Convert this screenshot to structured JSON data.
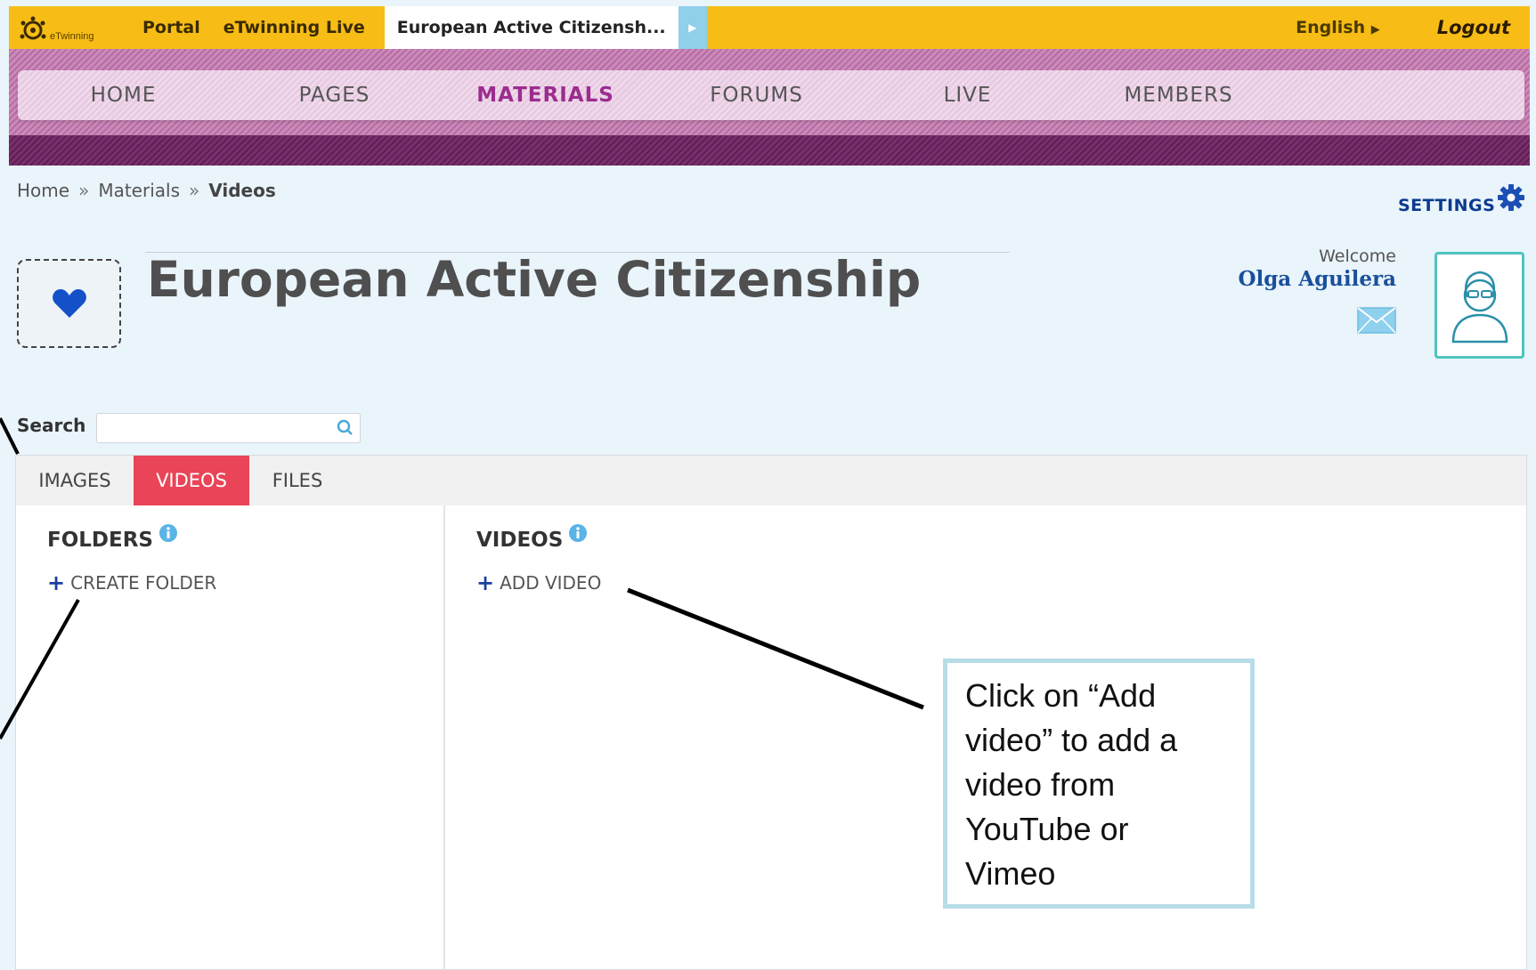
{
  "topbar": {
    "logo_text": "eTwinning",
    "links": [
      "Portal",
      "eTwinning Live"
    ],
    "active_tab": "European Active Citizensh...",
    "language": "English",
    "logout": "Logout"
  },
  "nav": {
    "items": [
      "HOME",
      "PAGES",
      "MATERIALS",
      "FORUMS",
      "LIVE",
      "MEMBERS"
    ],
    "active": "MATERIALS"
  },
  "breadcrumb": {
    "items": [
      "Home",
      "Materials"
    ],
    "current": "Videos",
    "separator": "»"
  },
  "settings_label": "SETTINGS",
  "project": {
    "title": "European Active Citizenship"
  },
  "user": {
    "welcome": "Welcome",
    "name": "Olga Aguilera"
  },
  "search": {
    "label": "Search",
    "value": "",
    "placeholder": ""
  },
  "tabs": [
    "IMAGES",
    "VIDEOS",
    "FILES"
  ],
  "folders": {
    "heading": "FOLDERS",
    "create_label": "CREATE FOLDER"
  },
  "videos": {
    "heading": "VIDEOS",
    "add_label": "ADD VIDEO"
  },
  "annotation": {
    "lines": [
      "Click on “Add",
      "video” to add a",
      "video from",
      "YouTube or",
      "Vimeo"
    ]
  },
  "colors": {
    "topbar": "#f7bd16",
    "nav_active": "#9b2d8f",
    "tab_active": "#e94457",
    "link_blue": "#1b4f9c",
    "avatar_border": "#4fc4c0"
  }
}
